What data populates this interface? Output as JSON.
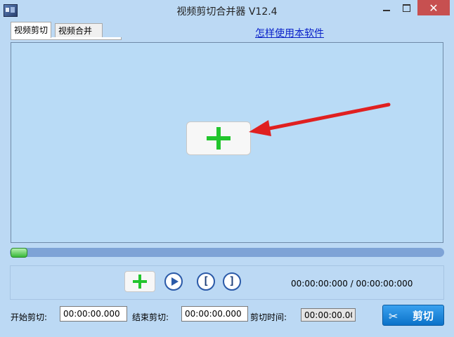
{
  "window": {
    "title": "视频剪切合并器 V12.4"
  },
  "tabs": [
    {
      "label": "视频剪切"
    },
    {
      "label": "视频合并"
    }
  ],
  "help_link": "怎样使用本软件",
  "playback": {
    "position": 0.0,
    "time_display": "00:00:00:000 / 00:00:00:000"
  },
  "bottom": {
    "start_label": "开始剪切:",
    "start_value": "00:00:00.000",
    "end_label": "结束剪切:",
    "end_value": "00:00:00.000",
    "duration_label": "剪切时间:",
    "duration_value": "00:00:00.000",
    "cut_label": "剪切"
  },
  "colors": {
    "accent": "#0b72c9",
    "plus_green": "#22c52d",
    "arrow_red": "#e02020"
  }
}
